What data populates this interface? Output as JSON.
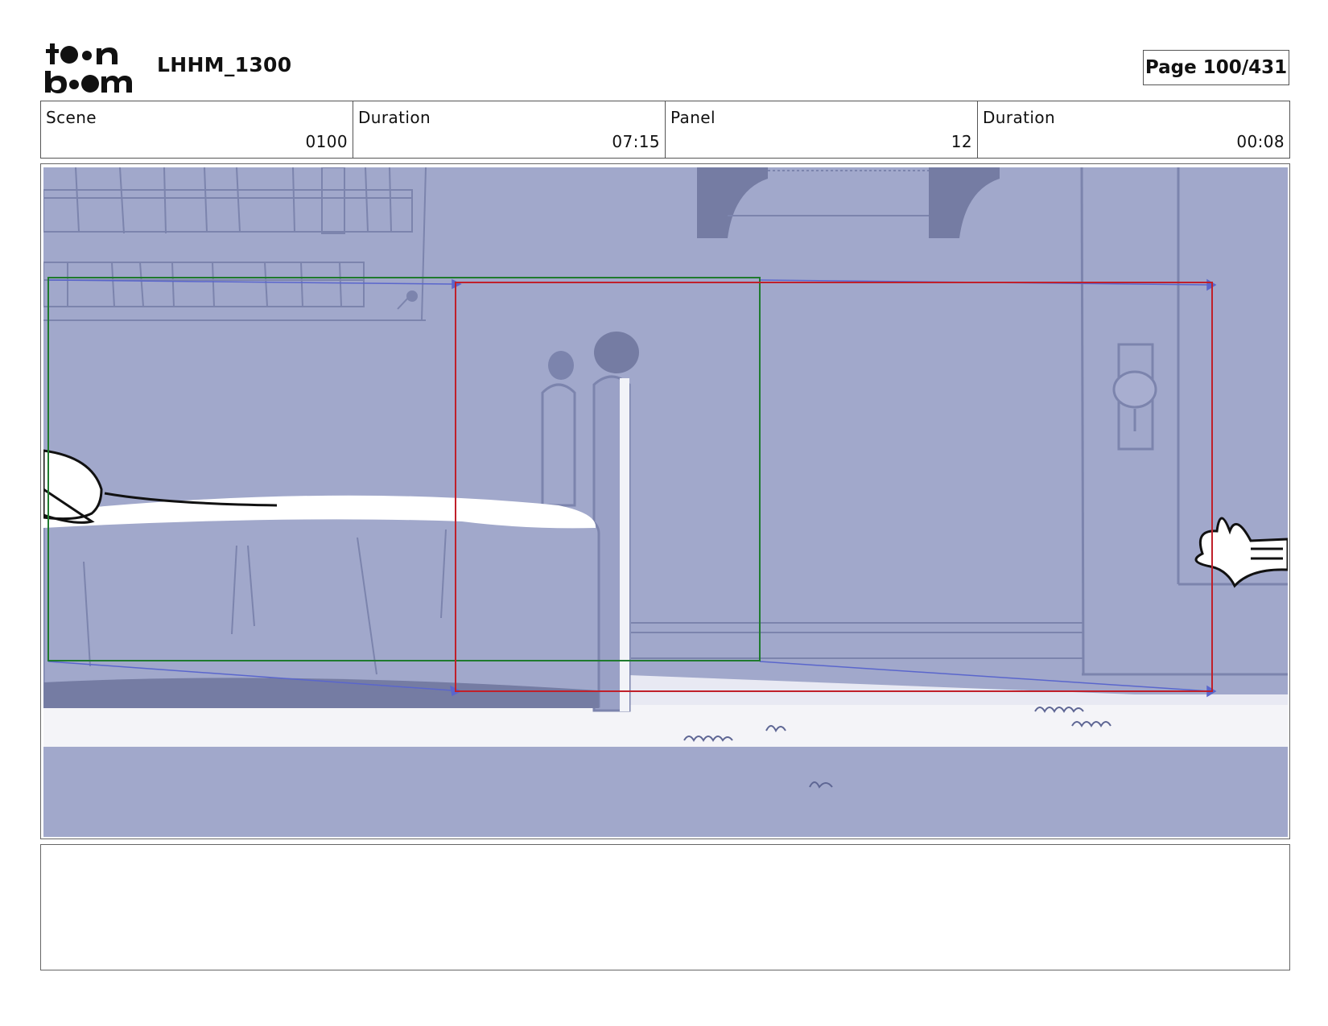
{
  "header": {
    "logo_icon": "toon-boom-logo",
    "project_title": "LHHM_1300",
    "page_label": "Page 100/431"
  },
  "info": {
    "scene_label": "Scene",
    "scene_value": "0100",
    "scene_duration_label": "Duration",
    "scene_duration_value": "07:15",
    "panel_label": "Panel",
    "panel_value": "12",
    "panel_duration_label": "Duration",
    "panel_duration_value": "00:08"
  },
  "panel": {
    "background_color": "#a1a8cb",
    "start_frame_color": "#1f7a2e",
    "end_frame_color": "#c0202a",
    "motion_path_color": "#5a66cc"
  },
  "notes": {
    "text": ""
  }
}
